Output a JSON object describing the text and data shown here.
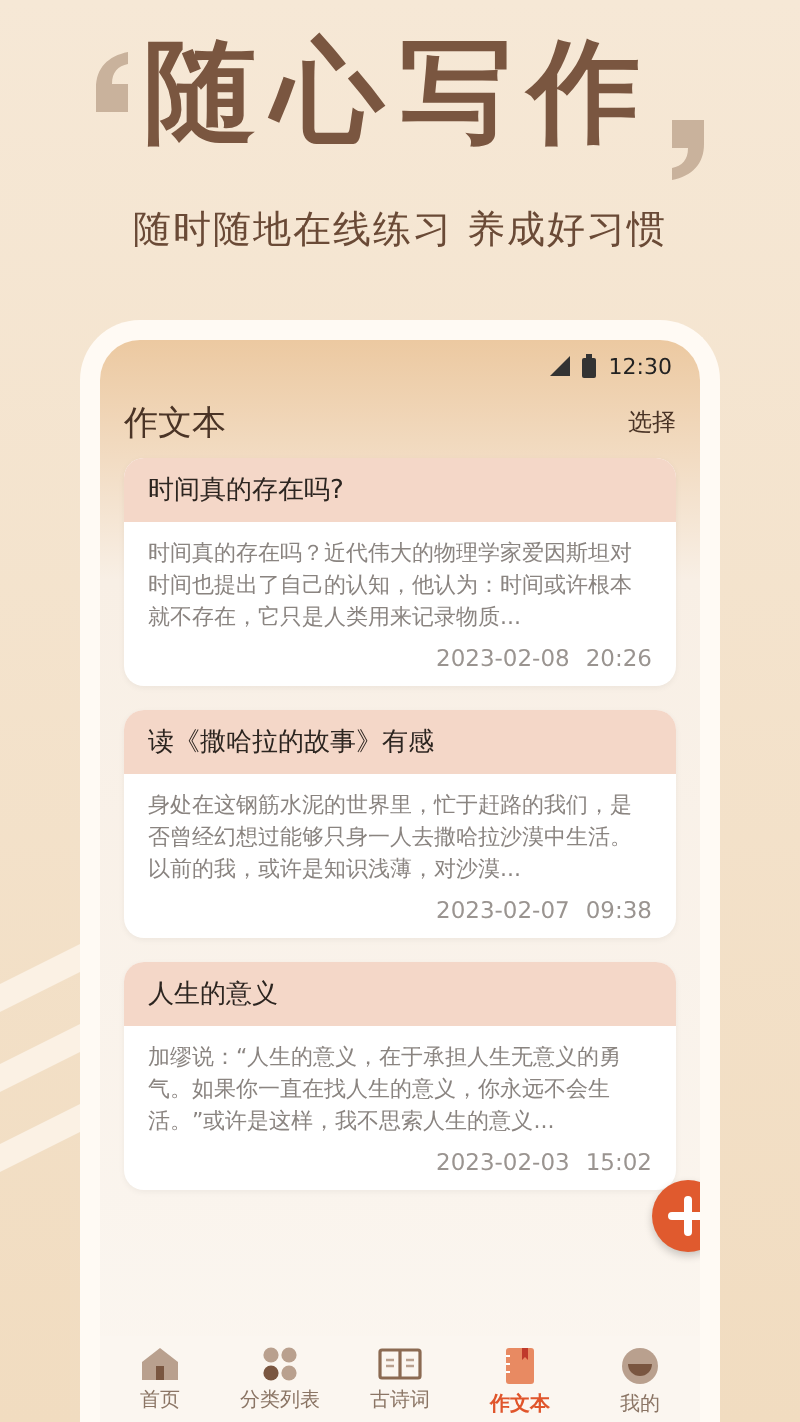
{
  "headline": "随心写作",
  "subtitle": "随时随地在线练习 养成好习惯",
  "status_bar": {
    "time": "12:30"
  },
  "header": {
    "title": "作文本",
    "action": "选择"
  },
  "essays": [
    {
      "title": "时间真的存在吗?",
      "excerpt": "时间真的存在吗？近代伟大的物理学家爱因斯坦对时间也提出了自己的认知，他认为：时间或许根本就不存在，它只是人类用来记录物质...",
      "date": "2023-02-08",
      "time": "20:26"
    },
    {
      "title": "读《撒哈拉的故事》有感",
      "excerpt": "身处在这钢筋水泥的世界里，忙于赶路的我们，是否曾经幻想过能够只身一人去撒哈拉沙漠中生活。以前的我，或许是知识浅薄，对沙漠...",
      "date": "2023-02-07",
      "time": "09:38"
    },
    {
      "title": "人生的意义",
      "excerpt": "加缪说：“人生的意义，在于承担人生无意义的勇气。如果你一直在找人生的意义，你永远不会生活。”或许是这样，我不思索人生的意义...",
      "date": "2023-02-03",
      "time": "15:02"
    }
  ],
  "tabs": [
    {
      "kind": "home",
      "label": "首页",
      "selected": false
    },
    {
      "kind": "grid",
      "label": "分类列表",
      "selected": false
    },
    {
      "kind": "book",
      "label": "古诗词",
      "selected": false
    },
    {
      "kind": "notebook",
      "label": "作文本",
      "selected": true
    },
    {
      "kind": "profile",
      "label": "我的",
      "selected": false
    }
  ]
}
